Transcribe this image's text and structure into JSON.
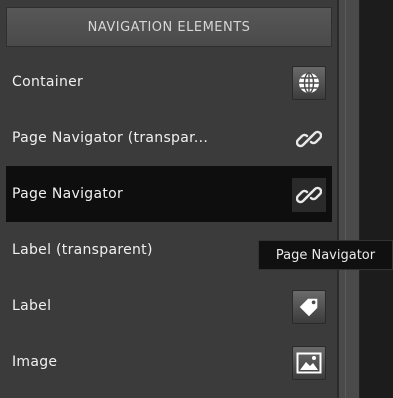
{
  "panel": {
    "header": "NAVIGATION ELEMENTS",
    "items": [
      {
        "label": "Container",
        "icon": "globe-icon"
      },
      {
        "label": "Page Navigator (transpar...",
        "icon": "link-icon"
      },
      {
        "label": "Page Navigator",
        "icon": "link-icon",
        "selected": true
      },
      {
        "label": "Label (transparent)",
        "icon": "tag-icon"
      },
      {
        "label": "Label",
        "icon": "tag-icon"
      },
      {
        "label": "Image",
        "icon": "image-icon"
      }
    ]
  },
  "tooltip": {
    "text": "Page Navigator"
  },
  "colors": {
    "panel_bg": "#3b3b3b",
    "selected_row": "#0e0e0e",
    "text": "#f0f0f0"
  }
}
